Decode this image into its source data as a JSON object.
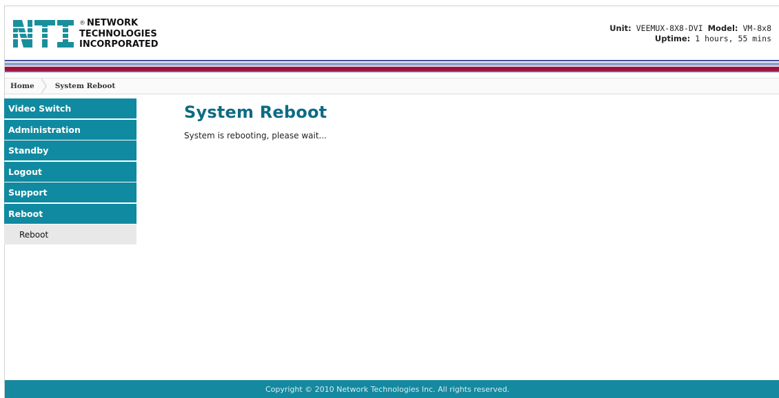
{
  "header": {
    "logo": {
      "mark_text": "NTI",
      "line1": "NETWORK",
      "line2": "TECHNOLOGIES",
      "line3": "INCORPORATED",
      "registered": "®"
    },
    "unit_label": "Unit:",
    "unit_value": "VEEMUX-8X8-DVI",
    "model_label": "Model:",
    "model_value": "VM-8x8",
    "uptime_label": "Uptime:",
    "uptime_value": "1 hours, 55 mins"
  },
  "breadcrumb": {
    "home": "Home",
    "current": "System Reboot"
  },
  "sidebar": {
    "items": [
      {
        "label": "Video Switch"
      },
      {
        "label": "Administration"
      },
      {
        "label": "Standby"
      },
      {
        "label": "Logout"
      },
      {
        "label": "Support"
      },
      {
        "label": "Reboot"
      }
    ],
    "subitems": [
      {
        "label": "Reboot"
      }
    ]
  },
  "main": {
    "title": "System Reboot",
    "message": "System is rebooting, please wait..."
  },
  "footer": {
    "copyright": "Copyright © 2010 Network Technologies Inc. All rights reserved."
  },
  "colors": {
    "nav_bg": "#0f8aa1",
    "title": "#0d6c83",
    "footer_bg": "#1589a0",
    "stripe_red": "#a0103c",
    "stripe_blue": "#3e4f9a",
    "logo_teal": "#1a8f9c"
  }
}
